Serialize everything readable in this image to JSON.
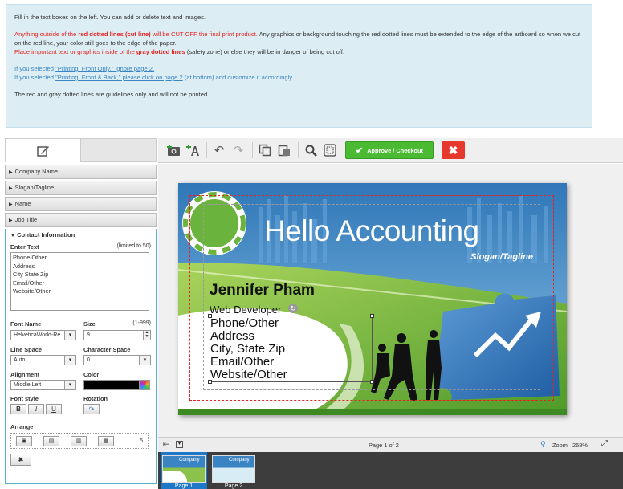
{
  "info": {
    "line1": "Fill in the text boxes on the left.  You can add or delete text and images.",
    "warn1_a": "Anything outside of the ",
    "warn1_b": "red dotted lines (cut line)",
    "warn1_c": " will be CUT OFF the final print product.",
    "warn1_d": "  Any graphics or background touching the red dotted lines must be extended to the edge of the artboard so when we cut on the red line, your color still goes to the edge of the paper.",
    "warn2_a": "Place important text or graphics inside of the ",
    "warn2_b": "gray dotted lines",
    "warn2_c": " (safety zone)",
    "warn2_d": " or else they will be in danger of being cut off.",
    "front_a": "If you selected ",
    "front_b": "\"Printing: Front Only,\" ignore page 2.",
    "back_a": "If you selected ",
    "back_b": "\"Printing: Front & Back,\" please click on page 2",
    "back_c": " (at bottom) and customize it accordingly.",
    "guide": "The red and gray dotted lines are guidelines only and will not be printed."
  },
  "left_panel": {
    "sections": [
      "Company Name",
      "Slogan/Tagline",
      "Name",
      "Job Title"
    ],
    "contact_title": "Contact Information",
    "enter_text_label": "Enter Text",
    "limit_label": "(limited to 50)",
    "text_value": "Phone/Other\nAddress\nCity State Zip\nEmail/Other\nWebsite/Other",
    "font_name_label": "Font Name",
    "font_name_value": "HelveticaWorld-Re",
    "size_label": "Size",
    "size_range": "(1-999)",
    "size_value": "9",
    "line_space_label": "Line Space",
    "line_space_value": "Auto",
    "char_space_label": "Character Space",
    "char_space_value": "0",
    "alignment_label": "Alignment",
    "alignment_value": "Middle Left",
    "color_label": "Color",
    "font_style_label": "Font style",
    "bold": "B",
    "italic": "I",
    "underline": "U",
    "rotation_label": "Rotation",
    "arrange_label": "Arrange",
    "arrange_value": "5"
  },
  "toolbar": {
    "approve_label": "Approve / Checkout"
  },
  "card": {
    "company": "Hello Accounting",
    "slogan": "Slogan/Tagline",
    "name": "Jennifer Pham",
    "title": "Web Developer",
    "contact": [
      "Phone/Other",
      "Address",
      "City, State Zip",
      "Email/Other",
      "Website/Other"
    ]
  },
  "footer": {
    "page_label": "Page 1 of 2",
    "zoom_label": "Zoom",
    "zoom_value": "268%"
  },
  "thumbs": {
    "page1": "Page 1",
    "page2": "Page 2",
    "mini_company": "Company"
  },
  "colors": {
    "cut_line": "#e8231f",
    "approve": "#4aba33",
    "delete": "#e7382e",
    "accent_border": "#5ab2c9"
  }
}
